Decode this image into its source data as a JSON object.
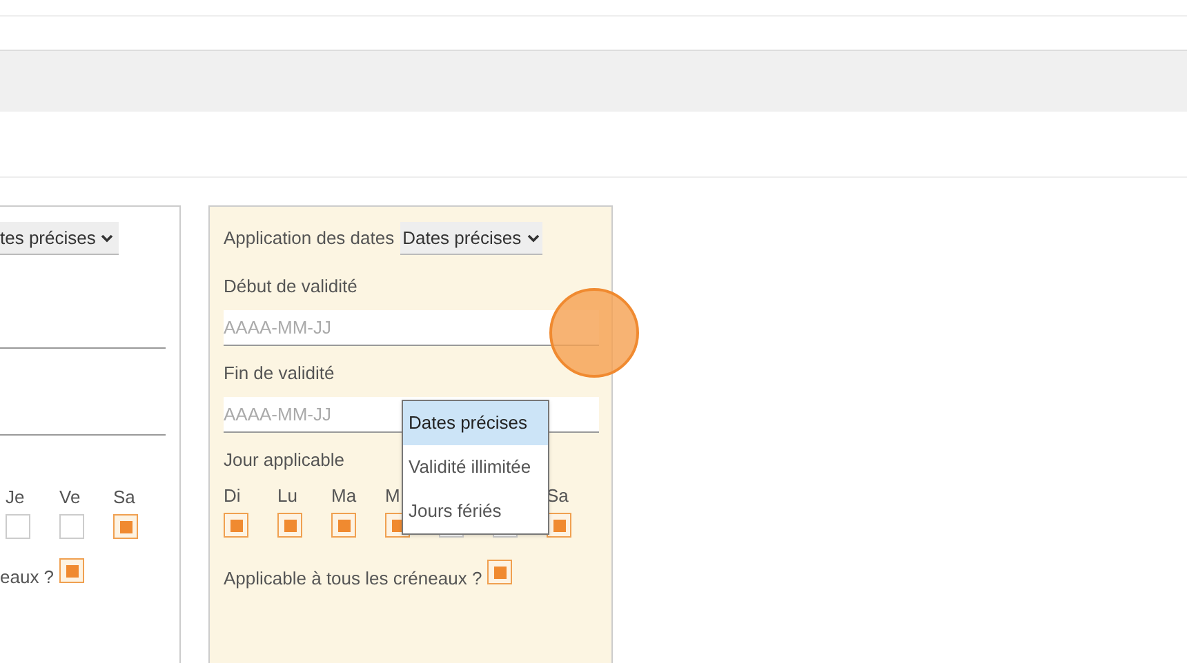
{
  "left_panel": {
    "select_value": "tes précises",
    "days": [
      {
        "label": "Je",
        "checked": false
      },
      {
        "label": "Ve",
        "checked": false
      },
      {
        "label": "Sa",
        "checked": true
      }
    ],
    "all_slots_label": "eaux ?",
    "all_slots_checked": true
  },
  "right_panel": {
    "application_label": "Application des dates",
    "application_value": "Dates précises",
    "start_label": "Début de validité",
    "start_placeholder": "AAAA-MM-JJ",
    "end_label": "Fin de validité",
    "end_placeholder": "AAAA-MM-JJ",
    "days_label": "Jour applicable",
    "days": [
      {
        "label": "Di",
        "checked": true
      },
      {
        "label": "Lu",
        "checked": true
      },
      {
        "label": "Ma",
        "checked": true
      },
      {
        "label": "M",
        "checked": true
      },
      {
        "checked": false
      },
      {
        "checked": false
      },
      {
        "label": "Sa",
        "checked": true
      }
    ],
    "all_slots_label": "Applicable à tous les créneaux ?",
    "all_slots_checked": true
  },
  "dropdown": {
    "options": [
      {
        "label": "Dates précises",
        "selected": true
      },
      {
        "label": "Validité illimitée",
        "selected": false
      },
      {
        "label": "Jours fériés",
        "selected": false
      }
    ]
  }
}
